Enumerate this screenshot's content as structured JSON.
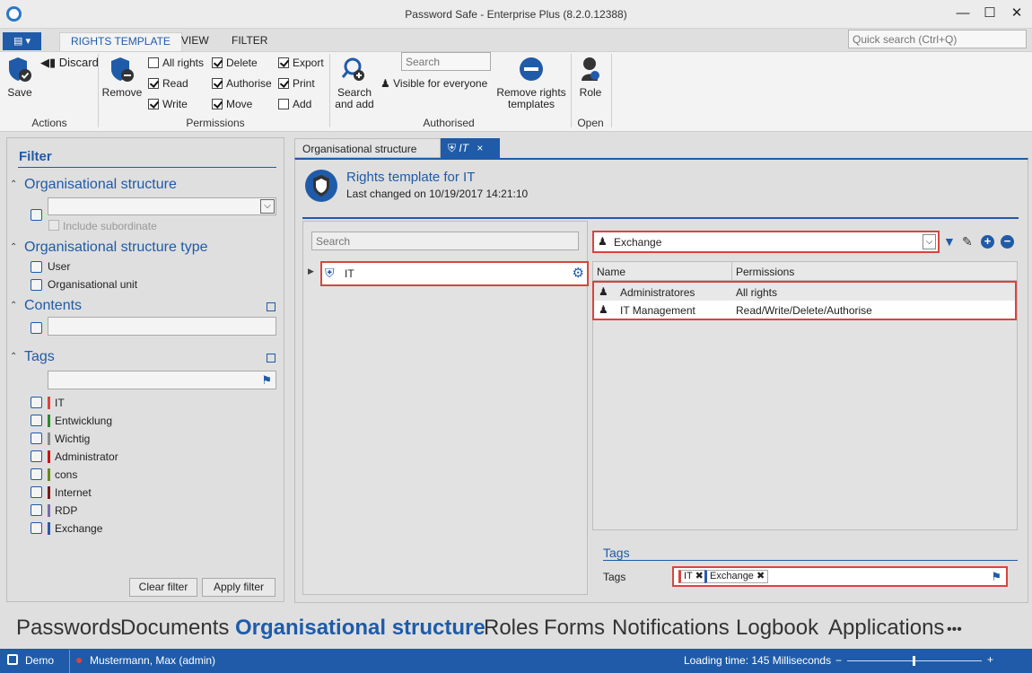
{
  "window": {
    "title": "Password Safe - Enterprise Plus (8.2.0.12388)"
  },
  "ribbon_tabs": [
    "RIGHTS TEMPLATE",
    "VIEW",
    "FILTER"
  ],
  "quick_search": {
    "placeholder": "Quick search (Ctrl+Q)"
  },
  "actions": {
    "save": "Save",
    "discard": "Discard",
    "group": "Actions"
  },
  "permissions": {
    "remove": "Remove",
    "group": "Permissions",
    "items": [
      {
        "label": "All rights",
        "checked": false
      },
      {
        "label": "Read",
        "checked": true
      },
      {
        "label": "Write",
        "checked": true
      },
      {
        "label": "Delete",
        "checked": true
      },
      {
        "label": "Authorise",
        "checked": true
      },
      {
        "label": "Move",
        "checked": true
      },
      {
        "label": "Export",
        "checked": true
      },
      {
        "label": "Print",
        "checked": true
      },
      {
        "label": "Add",
        "checked": false
      }
    ]
  },
  "authorised": {
    "search_and_add": "Search and add",
    "search_placeholder": "Search",
    "visible": "Visible for everyone",
    "remove_templates": "Remove rights templates",
    "group": "Authorised"
  },
  "open": {
    "role": "Role",
    "group": "Open"
  },
  "filter": {
    "title": "Filter",
    "org_structure": "Organisational structure",
    "include_subordinate": "Include subordinate",
    "org_type": "Organisational structure type",
    "org_type_items": [
      "User",
      "Organisational unit"
    ],
    "contents": "Contents",
    "tags": "Tags",
    "tag_items": [
      {
        "label": "IT",
        "color": "#d9443e"
      },
      {
        "label": "Entwicklung",
        "color": "#2a8a2a"
      },
      {
        "label": "Wichtig",
        "color": "#8a8a8a"
      },
      {
        "label": "Administrator",
        "color": "#cc1111"
      },
      {
        "label": "cons",
        "color": "#6a8a1a"
      },
      {
        "label": "Internet",
        "color": "#7a1a1a"
      },
      {
        "label": "RDP",
        "color": "#7a6aa8"
      },
      {
        "label": "Exchange",
        "color": "#2a5aa8"
      }
    ],
    "clear": "Clear filter",
    "apply": "Apply filter"
  },
  "doc_tabs": [
    "Organisational structure",
    "IT"
  ],
  "template": {
    "heading": "Rights template for IT",
    "changed": "Last changed on 10/19/2017 14:21:10",
    "search_placeholder": "Search",
    "tree_item": "IT",
    "dropdown": "Exchange",
    "columns": [
      "Name",
      "Permissions"
    ],
    "rows": [
      {
        "name": "Administratores",
        "permissions": "All rights"
      },
      {
        "name": "IT Management",
        "permissions": "Read/Write/Delete/Authorise"
      }
    ],
    "tags_section": "Tags",
    "tags_label": "Tags",
    "tags": [
      "IT",
      "Exchange"
    ]
  },
  "modules": [
    "Passwords",
    "Documents",
    "Organisational structure",
    "Roles",
    "Forms",
    "Notifications",
    "Logbook",
    "Applications",
    "•••"
  ],
  "status": {
    "db": "Demo",
    "user": "Mustermann, Max (admin)",
    "loading": "Loading time: 145 Milliseconds"
  },
  "colors": {
    "accent": "#1f5ba8",
    "highlight": "#d9443e"
  }
}
